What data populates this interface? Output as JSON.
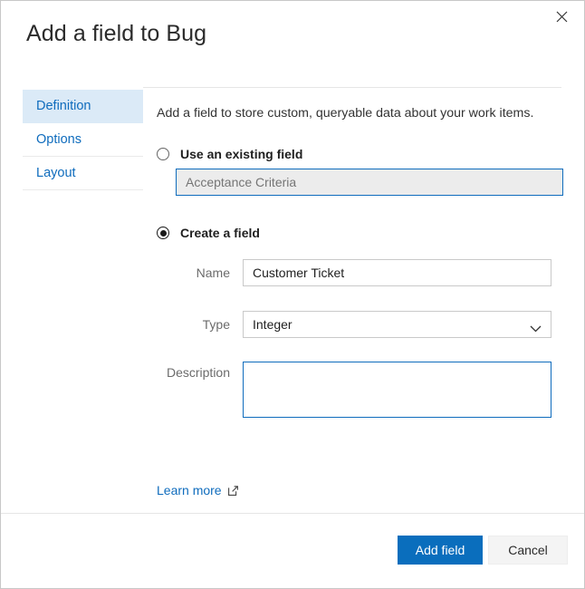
{
  "dialog": {
    "title": "Add a field to Bug",
    "close_icon": "close-icon"
  },
  "sidebar": {
    "items": [
      {
        "label": "Definition",
        "selected": true
      },
      {
        "label": "Options",
        "selected": false
      },
      {
        "label": "Layout",
        "selected": false
      }
    ]
  },
  "main": {
    "intro": "Add a field to store custom, queryable data about your work items.",
    "existing_field": {
      "radio_label": "Use an existing field",
      "selected": false,
      "value": "",
      "placeholder": "Acceptance Criteria",
      "disabled": true
    },
    "create_field": {
      "radio_label": "Create a field",
      "selected": true,
      "fields": {
        "name": {
          "label": "Name",
          "value": "Customer Ticket",
          "placeholder": ""
        },
        "type": {
          "label": "Type",
          "value": "Integer",
          "options": [
            "Integer"
          ],
          "chevron_icon": "chevron-down-icon"
        },
        "description": {
          "label": "Description",
          "value": "",
          "placeholder": ""
        }
      }
    },
    "learn_more": {
      "label": "Learn more",
      "icon": "external-link-icon"
    }
  },
  "footer": {
    "primary_label": "Add field",
    "secondary_label": "Cancel"
  },
  "colors": {
    "accent": "#0a6ebd",
    "link": "#0f6cbd",
    "selected_nav_bg": "#dbeaf7",
    "disabled_input_bg": "#ececec",
    "border": "#c8c8c8"
  }
}
